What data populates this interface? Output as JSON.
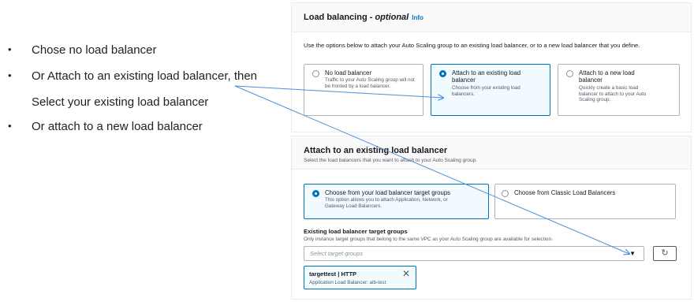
{
  "bullets": {
    "b1": "Chose no load balancer",
    "b2": "Or Attach to an existing load balancer, then",
    "b2_cont": "Select your existing load balancer",
    "b3": "Or attach to a new load balancer",
    "dot": "•"
  },
  "lb_panel": {
    "title": "Load balancing - ",
    "title_italic": "optional",
    "info": "Info",
    "description": "Use the options below to attach your Auto Scaling group to an existing load balancer, or to a new load balancer that you define.",
    "options": [
      {
        "label": "No load balancer",
        "desc": "Traffic to your Auto Scaling group will not be fronted by a load balancer.",
        "selected": false
      },
      {
        "label": "Attach to an existing load balancer",
        "desc": "Choose from your existing load balancers.",
        "selected": true
      },
      {
        "label": "Attach to a new load balancer",
        "desc": "Quickly create a basic load balancer to attach to your Auto Scaling group.",
        "selected": false
      }
    ]
  },
  "existing_panel": {
    "title": "Attach to an existing load balancer",
    "subtitle": "Select the load balancers that you want to attach to your Auto Scaling group.",
    "options": [
      {
        "label": "Choose from your load balancer target groups",
        "desc": "This option allows you to attach Application, Network, or Gateway Load Balancers.",
        "selected": true
      },
      {
        "label": "Choose from Classic Load Balancers",
        "desc": "",
        "selected": false
      }
    ],
    "field_label": "Existing load balancer target groups",
    "field_desc": "Only instance target groups that belong to the same VPC as your Auto Scaling group are available for selection.",
    "select_placeholder": "Select target groups",
    "token_title": "targettest | HTTP",
    "token_sub": "Application Load Balancer: alb-test"
  },
  "colors": {
    "accent": "#0073bb",
    "arrow": "#4a90d9"
  },
  "icons": {
    "caret": "▼",
    "refresh": "↻",
    "remove": "✕"
  }
}
